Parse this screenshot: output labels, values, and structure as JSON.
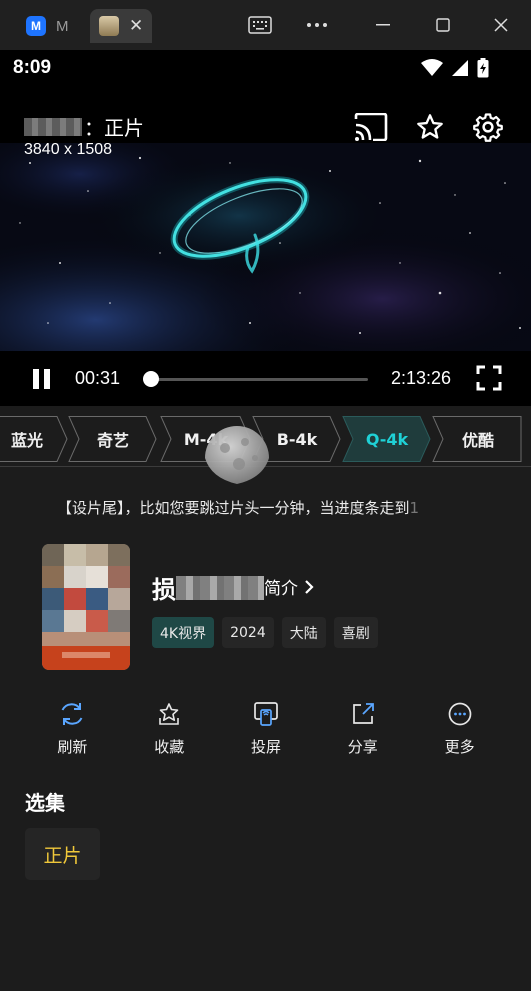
{
  "browser": {
    "tab1_label": "M",
    "tab1_icon": "app-logo-icon",
    "tab2_icon": "site-favicon-icon",
    "close_glyph": "✕"
  },
  "status": {
    "time": "8:09"
  },
  "player": {
    "title_suffix": "：正片",
    "resolution": "3840 x 1508",
    "current_time": "00:31",
    "total_time": "2:13:26",
    "progress": 0.004
  },
  "sources": [
    {
      "label": "蓝光",
      "active": false
    },
    {
      "label": "奇艺",
      "active": false
    },
    {
      "label": "M-4k",
      "active": false
    },
    {
      "label": "B-4k",
      "active": false
    },
    {
      "label": "Q-4k",
      "active": true
    },
    {
      "label": "优酷",
      "active": false
    }
  ],
  "notice": {
    "text": "【设片尾】，比如您要跳过片头一分钟，当进度条走到",
    "fade": "1"
  },
  "movie": {
    "name_first": "损",
    "intro_label": "简介",
    "tags": [
      "4K视界",
      "2024",
      "大陆",
      "喜剧"
    ]
  },
  "actions": [
    {
      "label": "刷新",
      "icon": "refresh-icon"
    },
    {
      "label": "收藏",
      "icon": "favorite-icon"
    },
    {
      "label": "投屏",
      "icon": "cast-screen-icon"
    },
    {
      "label": "分享",
      "icon": "share-icon"
    },
    {
      "label": "更多",
      "icon": "more-icon"
    }
  ],
  "episodes": {
    "title": "选集",
    "items": [
      "正片"
    ]
  },
  "colors": {
    "accent": "#1fd1d6",
    "episode_text": "#f0c83a",
    "tag_accent_bg": "#1f4846"
  }
}
